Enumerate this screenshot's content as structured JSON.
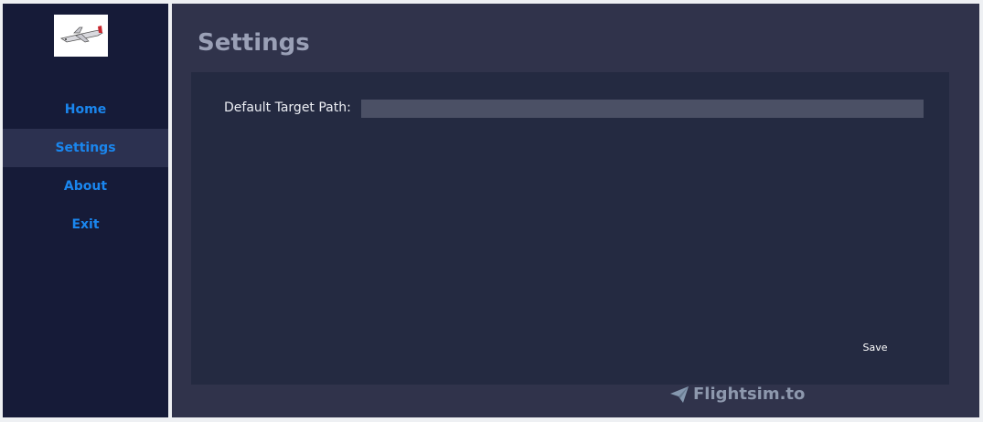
{
  "sidebar": {
    "logo_icon": "airplane-icon",
    "items": [
      {
        "label": "Home",
        "active": false
      },
      {
        "label": "Settings",
        "active": true
      },
      {
        "label": "About",
        "active": false
      },
      {
        "label": "Exit",
        "active": false
      }
    ]
  },
  "main": {
    "title": "Settings",
    "default_target_path": {
      "label": "Default Target Path:",
      "value": ""
    },
    "save_label": "Save"
  },
  "watermark": {
    "text": "Flightsim.to",
    "icon": "paper-plane-icon"
  },
  "colors": {
    "sidebar_bg": "#161b38",
    "nav_active_bg": "#2c3150",
    "nav_text": "#1a86ee",
    "main_bg": "#30334b",
    "panel_bg": "#242a41",
    "input_bg": "#4b5065"
  }
}
